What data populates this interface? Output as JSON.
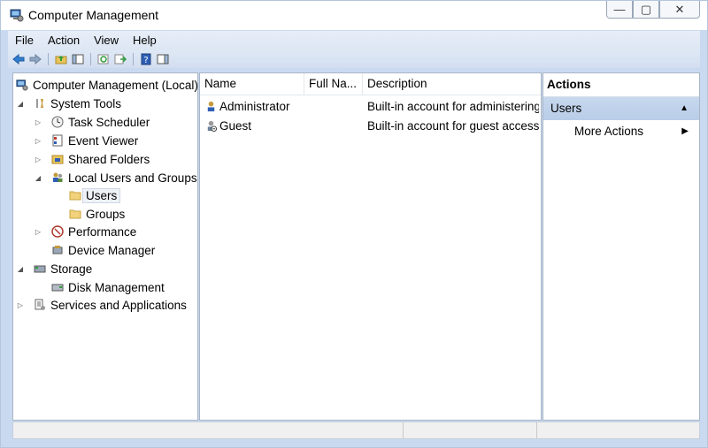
{
  "window": {
    "title": "Computer Management",
    "icon": "computer-management-icon"
  },
  "window_controls": {
    "minimize": "—",
    "maximize": "▢",
    "close": "✕"
  },
  "menu": [
    "File",
    "Action",
    "View",
    "Help"
  ],
  "toolbar": [
    {
      "name": "back-icon"
    },
    {
      "name": "forward-icon"
    },
    {
      "name": "up-folder-icon"
    },
    {
      "name": "show-hide-tree-icon"
    },
    {
      "name": "refresh-icon"
    },
    {
      "name": "export-list-icon"
    },
    {
      "name": "help-icon"
    },
    {
      "name": "show-hide-action-pane-icon"
    }
  ],
  "tree": [
    {
      "label": "Computer Management (Local)",
      "level": 0,
      "expander": "",
      "icon": "computer-management-icon"
    },
    {
      "label": "System Tools",
      "level": 0,
      "expander": "◢",
      "icon": "system-tools-icon"
    },
    {
      "label": "Task Scheduler",
      "level": 1,
      "expander": "▷",
      "icon": "clock-icon"
    },
    {
      "label": "Event Viewer",
      "level": 1,
      "expander": "▷",
      "icon": "event-viewer-icon"
    },
    {
      "label": "Shared Folders",
      "level": 1,
      "expander": "▷",
      "icon": "shared-folder-icon"
    },
    {
      "label": "Local Users and Groups",
      "level": 1,
      "expander": "◢",
      "icon": "users-groups-icon"
    },
    {
      "label": "Users",
      "level": 2,
      "expander": "",
      "icon": "folder-icon",
      "selected": true
    },
    {
      "label": "Groups",
      "level": 2,
      "expander": "",
      "icon": "folder-icon"
    },
    {
      "label": "Performance",
      "level": 1,
      "expander": "▷",
      "icon": "performance-icon"
    },
    {
      "label": "Device Manager",
      "level": 1,
      "expander": "",
      "icon": "device-manager-icon"
    },
    {
      "label": "Storage",
      "level": 0,
      "expander": "◢",
      "icon": "storage-icon"
    },
    {
      "label": "Disk Management",
      "level": 1,
      "expander": "",
      "icon": "disk-management-icon"
    },
    {
      "label": "Services and Applications",
      "level": 0,
      "expander": "▷",
      "icon": "services-icon"
    }
  ],
  "list": {
    "columns": [
      "Name",
      "Full Na...",
      "Description"
    ],
    "rows": [
      {
        "name": "Administrator",
        "full_name": "",
        "description": "Built-in account for administering",
        "icon": "user-icon"
      },
      {
        "name": "Guest",
        "full_name": "",
        "description": "Built-in account for guest access t",
        "icon": "user-disabled-icon"
      }
    ]
  },
  "actions": {
    "header": "Actions",
    "group": "Users",
    "group_arrow": "▲",
    "items": [
      {
        "label": "More Actions",
        "arrow": "▶"
      }
    ]
  }
}
